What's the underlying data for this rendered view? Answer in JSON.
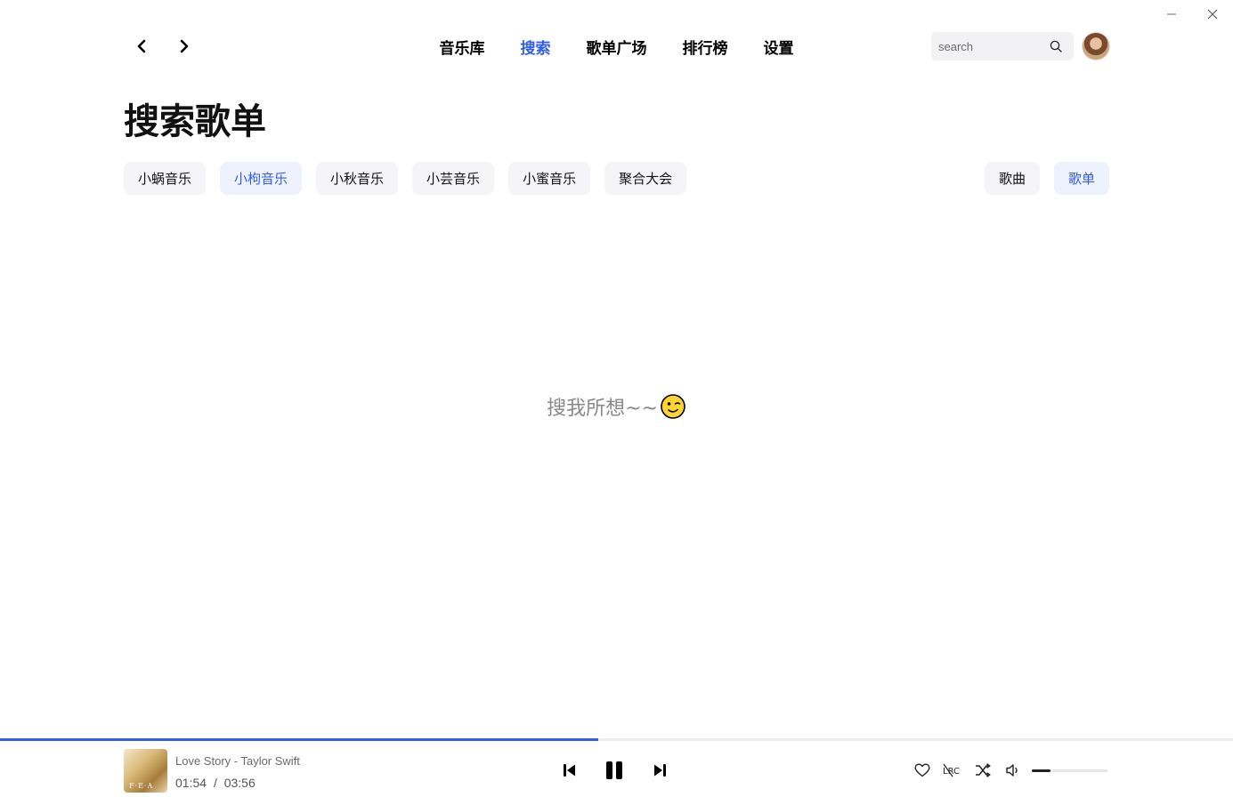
{
  "window": {
    "minimize_icon": "minimize-icon",
    "close_icon": "close-icon"
  },
  "nav": {
    "back_icon": "chevron-left-icon",
    "forward_icon": "chevron-right-icon",
    "items": [
      {
        "label": "音乐库",
        "active": false
      },
      {
        "label": "搜索",
        "active": true
      },
      {
        "label": "歌单广场",
        "active": false
      },
      {
        "label": "排行榜",
        "active": false
      },
      {
        "label": "设置",
        "active": false
      }
    ]
  },
  "search": {
    "placeholder": "search",
    "value": "",
    "icon": "search-icon"
  },
  "page": {
    "title": "搜索歌单"
  },
  "sources": [
    {
      "label": "小蜗音乐",
      "active": false
    },
    {
      "label": "小枸音乐",
      "active": true
    },
    {
      "label": "小秋音乐",
      "active": false
    },
    {
      "label": "小芸音乐",
      "active": false
    },
    {
      "label": "小蜜音乐",
      "active": false
    },
    {
      "label": "聚合大会",
      "active": false
    }
  ],
  "types": [
    {
      "label": "歌曲",
      "active": false
    },
    {
      "label": "歌单",
      "active": true
    }
  ],
  "empty": {
    "text": "搜我所想~~",
    "icon": "winking-face-icon"
  },
  "player": {
    "song": "Love Story - Taylor Swift",
    "current": "01:54",
    "separator": "/",
    "duration": "03:56",
    "progress_fraction": 0.485,
    "volume_fraction": 0.25,
    "cover_text": "F·E·A",
    "icons": [
      "previous-icon",
      "pause-icon",
      "next-icon",
      "heart-icon",
      "lyrics-icon",
      "shuffle-icon",
      "volume-icon"
    ]
  },
  "colors": {
    "accent": "#335eea",
    "chip_bg": "#f5f5f7",
    "chip_active_bg": "#eef2fd",
    "muted_text": "#888888"
  }
}
